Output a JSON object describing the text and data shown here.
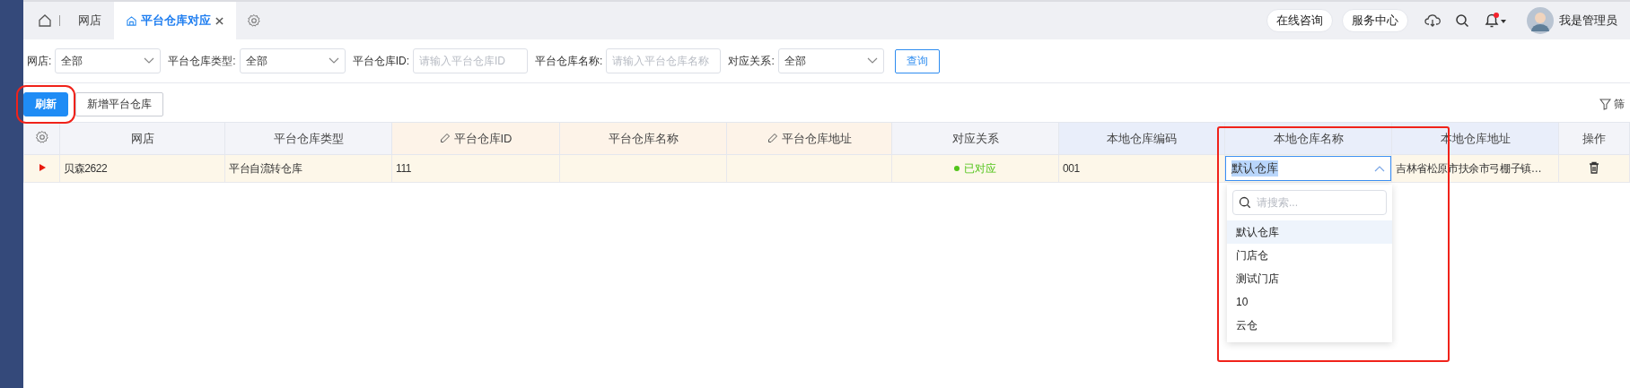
{
  "tabs": [
    {
      "label": "网店",
      "selected": false,
      "closable": false
    },
    {
      "label": "平台仓库对应",
      "selected": true,
      "closable": true
    }
  ],
  "header_buttons": [
    "在线咨询",
    "服务中心"
  ],
  "notifications": {
    "unread": true
  },
  "user": {
    "name": "我是管理员"
  },
  "filters": [
    {
      "kind": "select",
      "label": "网店:",
      "value": "全部"
    },
    {
      "kind": "select",
      "label": "平台仓库类型:",
      "value": "全部"
    },
    {
      "kind": "input",
      "label": "平台仓库ID:",
      "placeholder": "请输入平台仓库ID"
    },
    {
      "kind": "input",
      "label": "平台仓库名称:",
      "placeholder": "请输入平台仓库名称"
    },
    {
      "kind": "select",
      "label": "对应关系:",
      "value": "全部"
    }
  ],
  "query_button": "查询",
  "toolbar": {
    "buttons": [
      {
        "label": "刷新",
        "kind": "primary",
        "highlighted": true
      },
      {
        "label": "新增平台仓库",
        "kind": "default",
        "highlighted": false
      }
    ],
    "filter_link": "筛"
  },
  "table": {
    "columns": [
      {
        "label": "网店",
        "color": "#f3f4f9",
        "editable": false
      },
      {
        "label": "平台仓库类型",
        "color": "#f3f4f9",
        "editable": false
      },
      {
        "label": "平台仓库ID",
        "color": "#fdf3e8",
        "editable": true
      },
      {
        "label": "平台仓库名称",
        "color": "#fdf3e8",
        "editable": false
      },
      {
        "label": "平台仓库地址",
        "color": "#fdf3e8",
        "editable": true
      },
      {
        "label": "对应关系",
        "color": "#f3f4f9",
        "editable": false
      },
      {
        "label": "本地仓库编码",
        "color": "#e9eefa",
        "editable": false
      },
      {
        "label": "本地仓库名称",
        "color": "#e9eefa",
        "editable": false
      },
      {
        "label": "本地仓库地址",
        "color": "#e9eefa",
        "editable": false
      },
      {
        "label": "操作",
        "color": "#f3f4f9",
        "editable": false
      }
    ],
    "rows": [
      {
        "expanded": false,
        "cells": [
          {
            "kind": "text",
            "text": "贝森2622"
          },
          {
            "kind": "text",
            "text": "平台自流转仓库"
          },
          {
            "kind": "text",
            "text": "111"
          },
          {
            "kind": "text",
            "text": ""
          },
          {
            "kind": "text",
            "text": ""
          },
          {
            "kind": "status",
            "text": "已对应",
            "color": "#52c41a"
          },
          {
            "kind": "text",
            "text": "001"
          },
          {
            "kind": "select",
            "value": "默认仓库",
            "value_highlighted": true,
            "open": true,
            "highlighted": true,
            "search_placeholder": "请搜索...",
            "options": [
              {
                "label": "默认仓库",
                "selected": true
              },
              {
                "label": "门店仓",
                "selected": false
              },
              {
                "label": "测试门店",
                "selected": false
              },
              {
                "label": "10",
                "selected": false
              },
              {
                "label": "云仓",
                "selected": false
              }
            ]
          },
          {
            "kind": "text",
            "text": "吉林省松原市扶余市弓棚子镇…"
          },
          {
            "kind": "delete"
          }
        ]
      }
    ]
  }
}
